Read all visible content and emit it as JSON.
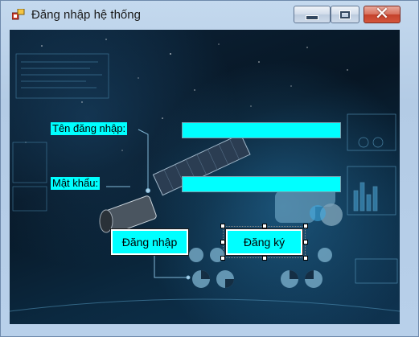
{
  "window": {
    "title": "Đăng nhập hệ thống",
    "icon": "app-forms-icon",
    "controls": [
      "minimize-icon",
      "maximize-icon",
      "close-icon"
    ]
  },
  "form": {
    "username_label": "Tên đăng nhập:",
    "password_label": "Mật khẩu:",
    "username_value": "",
    "password_value": "",
    "login_button": "Đăng nhập",
    "register_button": "Đăng ký"
  },
  "colors": {
    "control_bg": "#00ffff",
    "background": "#0a2033"
  }
}
